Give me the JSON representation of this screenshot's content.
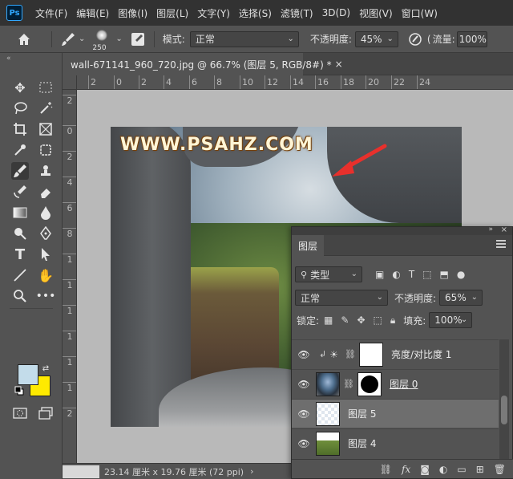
{
  "menu": [
    "文件(F)",
    "编辑(E)",
    "图像(I)",
    "图层(L)",
    "文字(Y)",
    "选择(S)",
    "滤镜(T)",
    "3D(D)",
    "视图(V)",
    "窗口(W)"
  ],
  "app_logo": "Ps",
  "options_bar": {
    "brush_size": "250",
    "mode_label": "模式:",
    "mode_value": "正常",
    "opacity_label": "不透明度:",
    "opacity_value": "45%",
    "flow_label": "流量:",
    "flow_value": "100%"
  },
  "document": {
    "tab_title": "wall-671141_960_720.jpg @ 66.7% (图层 5, RGB/8#) *",
    "close_glyph": "×",
    "watermark": "WWW.PSAHZ.COM",
    "status_text": "23.14 厘米 x 19.76 厘米 (72 ppi)",
    "status_chevron": "›"
  },
  "rulers": {
    "horizontal": [
      "2",
      "0",
      "2",
      "4",
      "6",
      "8",
      "10",
      "12",
      "14",
      "16",
      "18",
      "20",
      "22",
      "24"
    ],
    "vertical": [
      "2",
      "0",
      "2",
      "4",
      "6",
      "8",
      "1",
      "1",
      "1",
      "1",
      "1",
      "1",
      "2"
    ]
  },
  "layers_panel": {
    "tab_label": "图层",
    "filter_value": "类型",
    "blend_mode": "正常",
    "opacity_label": "不透明度:",
    "opacity_value": "65%",
    "lock_label": "锁定:",
    "fill_label": "填充:",
    "fill_value": "100%",
    "layers": [
      {
        "name": "亮度/对比度 1",
        "visible": true,
        "selected": false,
        "thumb": "white"
      },
      {
        "name": "图层 0",
        "visible": true,
        "selected": false,
        "thumb": "photo"
      },
      {
        "name": "图层 5",
        "visible": true,
        "selected": true,
        "thumb": "checker"
      },
      {
        "name": "图层 4",
        "visible": true,
        "selected": false,
        "thumb": "grass"
      }
    ],
    "bottom_icons": [
      "link-icon",
      "fx-icon",
      "mask-icon",
      "adjustment-icon",
      "group-icon",
      "new-layer-icon",
      "trash-icon"
    ]
  },
  "colors": {
    "foreground": "#c3dcea",
    "background": "#ffea00",
    "accent": "#31a8ff"
  }
}
